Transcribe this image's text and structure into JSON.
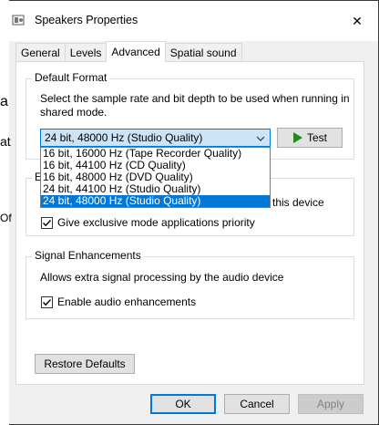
{
  "background": {
    "glyphs": [
      "a",
      "at",
      "Of"
    ]
  },
  "window": {
    "title": "Speakers Properties",
    "close_glyph": "✕"
  },
  "tabs": [
    {
      "label": "General",
      "active": false
    },
    {
      "label": "Levels",
      "active": false
    },
    {
      "label": "Advanced",
      "active": true
    },
    {
      "label": "Spatial sound",
      "active": false
    }
  ],
  "default_format": {
    "legend": "Default Format",
    "description": "Select the sample rate and bit depth to be used when running in shared mode.",
    "selected_value": "24 bit, 48000 Hz (Studio Quality)",
    "test_label": "Test",
    "options": [
      "16 bit, 16000 Hz (Tape Recorder Quality)",
      "16 bit, 44100 Hz (CD Quality)",
      "16 bit, 48000 Hz (DVD Quality)",
      "24 bit, 44100 Hz (Studio Quality)",
      "24 bit, 48000 Hz (Studio Quality)"
    ],
    "highlighted_option_index": 4
  },
  "exclusive_mode": {
    "legend_partial": "E",
    "allow_label_partial": "this device",
    "priority_label": "Give exclusive mode applications priority",
    "priority_checked": true
  },
  "signal_enhancements": {
    "legend": "Signal Enhancements",
    "description": "Allows extra signal processing by the audio device",
    "enable_label": "Enable audio enhancements",
    "enable_checked": true
  },
  "restore_defaults_label": "Restore Defaults",
  "footer": {
    "ok_label": "OK",
    "cancel_label": "Cancel",
    "apply_label": "Apply"
  },
  "colors": {
    "accent": "#0078d7",
    "selection_bg": "#cce4f7",
    "play_green": "#1e8a1e"
  }
}
